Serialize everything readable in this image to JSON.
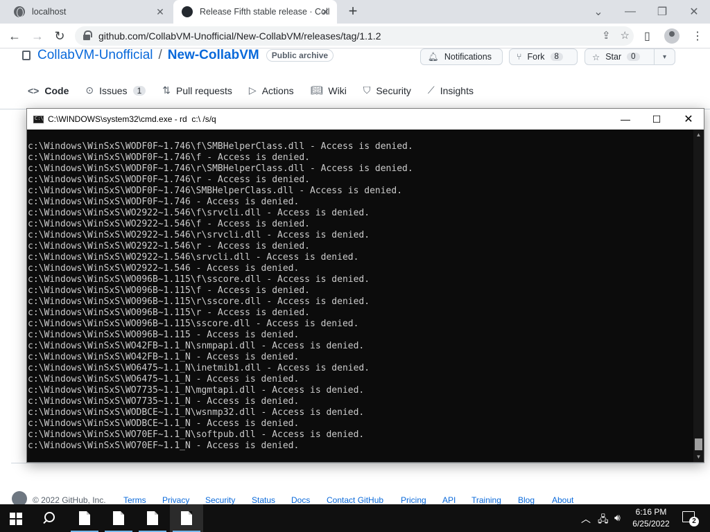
{
  "browser": {
    "tabs": [
      {
        "title": "localhost",
        "active": false
      },
      {
        "title": "Release Fifth stable release · Coll",
        "active": true
      }
    ],
    "url": "github.com/CollabVM-Unofficial/New-CollabVM/releases/tag/1.1.2"
  },
  "repo": {
    "owner": "CollabVM-Unofficial",
    "separator": "/",
    "name": "New-CollabVM",
    "badge": "Public archive",
    "notifications_label": "Notifications",
    "fork_label": "Fork",
    "fork_count": "8",
    "star_label": "Star",
    "star_count": "0",
    "nav": [
      {
        "label": "Code"
      },
      {
        "label": "Issues",
        "count": "1"
      },
      {
        "label": "Pull requests"
      },
      {
        "label": "Actions"
      },
      {
        "label": "Wiki"
      },
      {
        "label": "Security"
      },
      {
        "label": "Insights"
      }
    ]
  },
  "cmd": {
    "title": "C:\\WINDOWS\\system32\\cmd.exe - rd  c:\\ /s/q",
    "lines": [
      "c:\\Windows\\WinSxS\\WODF0F~1.746\\f\\SMBHelperClass.dll - Access is denied.",
      "c:\\Windows\\WinSxS\\WODF0F~1.746\\f - Access is denied.",
      "c:\\Windows\\WinSxS\\WODF0F~1.746\\r\\SMBHelperClass.dll - Access is denied.",
      "c:\\Windows\\WinSxS\\WODF0F~1.746\\r - Access is denied.",
      "c:\\Windows\\WinSxS\\WODF0F~1.746\\SMBHelperClass.dll - Access is denied.",
      "c:\\Windows\\WinSxS\\WODF0F~1.746 - Access is denied.",
      "c:\\Windows\\WinSxS\\WO2922~1.546\\f\\srvcli.dll - Access is denied.",
      "c:\\Windows\\WinSxS\\WO2922~1.546\\f - Access is denied.",
      "c:\\Windows\\WinSxS\\WO2922~1.546\\r\\srvcli.dll - Access is denied.",
      "c:\\Windows\\WinSxS\\WO2922~1.546\\r - Access is denied.",
      "c:\\Windows\\WinSxS\\WO2922~1.546\\srvcli.dll - Access is denied.",
      "c:\\Windows\\WinSxS\\WO2922~1.546 - Access is denied.",
      "c:\\Windows\\WinSxS\\WO096B~1.115\\f\\sscore.dll - Access is denied.",
      "c:\\Windows\\WinSxS\\WO096B~1.115\\f - Access is denied.",
      "c:\\Windows\\WinSxS\\WO096B~1.115\\r\\sscore.dll - Access is denied.",
      "c:\\Windows\\WinSxS\\WO096B~1.115\\r - Access is denied.",
      "c:\\Windows\\WinSxS\\WO096B~1.115\\sscore.dll - Access is denied.",
      "c:\\Windows\\WinSxS\\WO096B~1.115 - Access is denied.",
      "c:\\Windows\\WinSxS\\WO42FB~1.1_N\\snmpapi.dll - Access is denied.",
      "c:\\Windows\\WinSxS\\WO42FB~1.1_N - Access is denied.",
      "c:\\Windows\\WinSxS\\WO6475~1.1_N\\inetmib1.dll - Access is denied.",
      "c:\\Windows\\WinSxS\\WO6475~1.1_N - Access is denied.",
      "c:\\Windows\\WinSxS\\WO7735~1.1_N\\mgmtapi.dll - Access is denied.",
      "c:\\Windows\\WinSxS\\WO7735~1.1_N - Access is denied.",
      "c:\\Windows\\WinSxS\\WODBCE~1.1_N\\wsnmp32.dll - Access is denied.",
      "c:\\Windows\\WinSxS\\WODBCE~1.1_N - Access is denied.",
      "c:\\Windows\\WinSxS\\WO70EF~1.1_N\\softpub.dll - Access is denied.",
      "c:\\Windows\\WinSxS\\WO70EF~1.1_N - Access is denied."
    ]
  },
  "footer": {
    "copyright": "© 2022 GitHub, Inc.",
    "links": [
      "Terms",
      "Privacy",
      "Security",
      "Status",
      "Docs",
      "Contact GitHub",
      "Pricing",
      "API",
      "Training",
      "Blog",
      "About"
    ]
  },
  "taskbar": {
    "time": "6:16 PM",
    "date": "6/25/2022",
    "notification_count": "2"
  },
  "colors": {
    "link": "#0969da",
    "console_bg": "#0c0c0c",
    "console_text": "#cccccc",
    "taskbar_bg": "#101010"
  },
  "icons": {
    "tab_localhost": "globe-icon",
    "tab_release": "github-icon",
    "back": "arrow-left-icon",
    "forward": "arrow-right-icon",
    "reload": "reload-icon",
    "lock": "lock-icon",
    "share": "share-icon",
    "bookmark": "star-outline-icon",
    "sidepanel": "side-panel-icon",
    "profile": "profile-avatar-icon",
    "menu": "kebab-menu-icon",
    "bell": "bell-icon",
    "fork": "fork-icon",
    "star": "star-icon",
    "start": "windows-start-icon",
    "search": "search-icon"
  }
}
